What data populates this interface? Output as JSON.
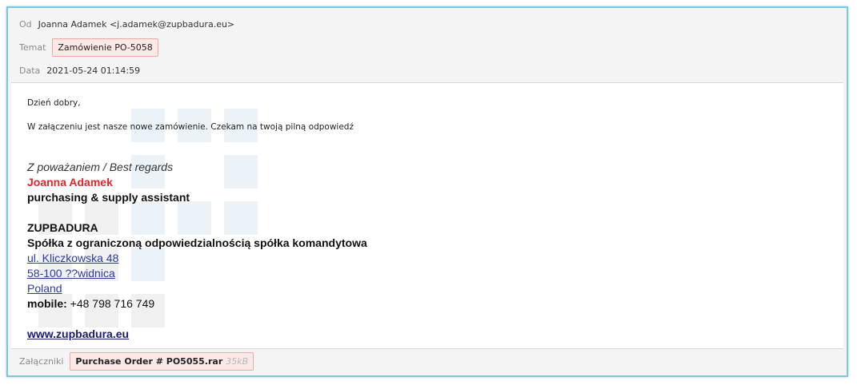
{
  "header": {
    "from_label": "Od",
    "from_value": "Joanna Adamek <j.adamek@zupbadura.eu>",
    "subject_label": "Temat",
    "subject_value": "Zamówienie PO-5058",
    "date_label": "Data",
    "date_value": "2021-05-24 01:14:59"
  },
  "body": {
    "greeting": "Dzień dobry,",
    "message": "W załączeniu jest nasze nowe zamówienie. Czekam na twoją pilną odpowiedź",
    "signature": {
      "regards": "Z poważaniem / Best regards",
      "name": "Joanna Adamek",
      "role": "purchasing & supply assistant",
      "company": "ZUPBADURA",
      "company_full": "Spółka z ograniczoną odpowiedzialnością spółka komandytowa",
      "street": "ul. Kliczkowska 48",
      "city": "58-100 ??widnica",
      "country": "Poland",
      "mobile_label": "mobile:",
      "mobile_value": " +48 798 716 749",
      "website": "www.zupbadura.eu"
    }
  },
  "attachments": {
    "label": "Załączniki",
    "items": [
      {
        "name": "Purchase Order # PO5055.rar",
        "size": "35kB"
      }
    ]
  },
  "colors": {
    "frame_border": "#7fc6d8",
    "highlight_bg": "#fbe9e7",
    "highlight_border": "#f0a8a0",
    "signature_name": "#e0262b",
    "link": "#2a3aa8"
  }
}
